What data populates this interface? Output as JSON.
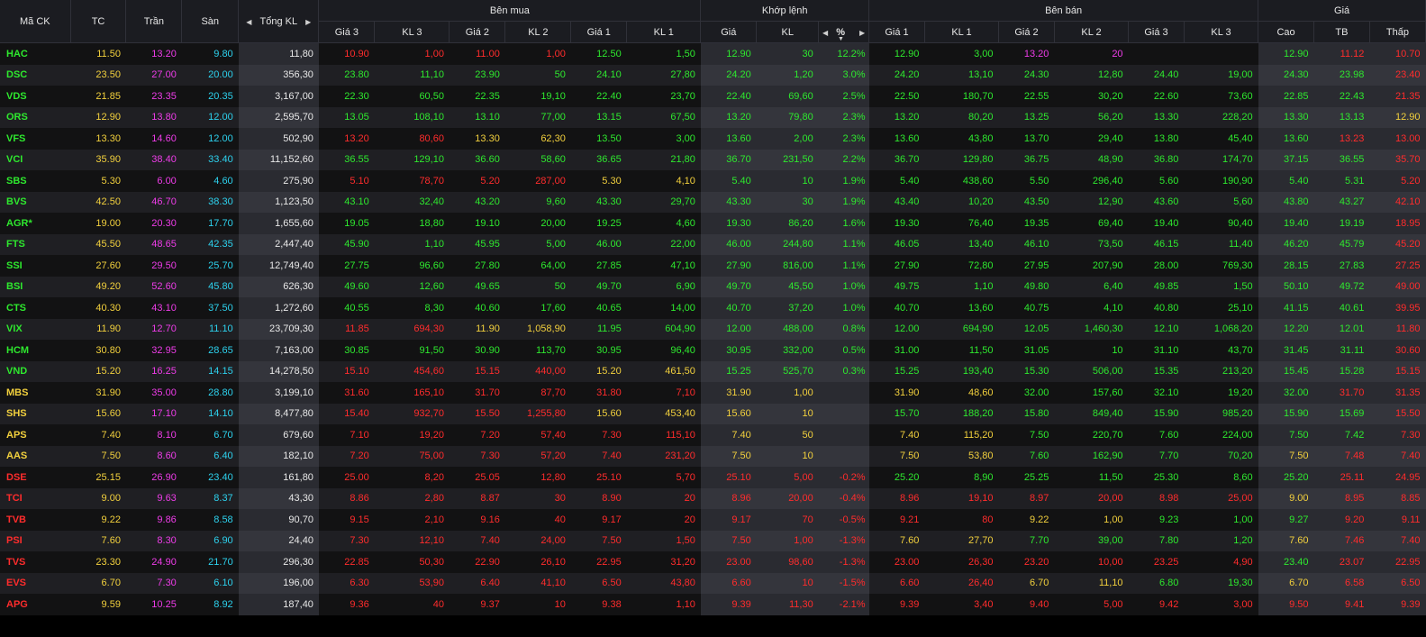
{
  "header": {
    "symbol": "Mã CK",
    "ref": "TC",
    "ceiling": "Trần",
    "floor": "Sàn",
    "total_vol": "Tổng KL",
    "bid_group": "Bên mua",
    "match_group": "Khớp lệnh",
    "ask_group": "Bên bán",
    "price_group": "Giá",
    "bid_cols": [
      "Giá 3",
      "KL 3",
      "Giá 2",
      "KL 2",
      "Giá 1",
      "KL 1"
    ],
    "match_cols": [
      "Giá",
      "KL",
      "%"
    ],
    "ask_cols": [
      "Giá 1",
      "KL 1",
      "Giá 2",
      "KL 2",
      "Giá 3",
      "KL 3"
    ],
    "price_cols": [
      "Cao",
      "TB",
      "Thấp"
    ]
  },
  "colors": {
    "ref": "#f2d03d",
    "ceiling": "#ee3ce8",
    "floor": "#2dd2ee",
    "up": "#2ee82e",
    "down": "#ff2c2c",
    "neutral": "#e8e8e8",
    "background": "#000000",
    "header": "#1b1c21"
  },
  "rows": [
    {
      "sym": "HAC",
      "tc": "11.50",
      "tran": "13.20",
      "san": "9.80",
      "tkl": "11,80",
      "b3": "10.90",
      "bkl3": "1,00",
      "b2": "11.00",
      "bkl2": "1,00",
      "b1": "12.50",
      "bkl1": "1,50",
      "mp": "12.90",
      "mkl": "30",
      "pct": "12.2%",
      "a1": "12.90",
      "akl1": "3,00",
      "a2": "13.20",
      "akl2": "20",
      "a3": "",
      "akl3": "",
      "cao": "12.90",
      "tb": "11.12",
      "thap": "10.70"
    },
    {
      "sym": "DSC",
      "tc": "23.50",
      "tran": "27.00",
      "san": "20.00",
      "tkl": "356,30",
      "b3": "23.80",
      "bkl3": "11,10",
      "b2": "23.90",
      "bkl2": "50",
      "b1": "24.10",
      "bkl1": "27,80",
      "mp": "24.20",
      "mkl": "1,20",
      "pct": "3.0%",
      "a1": "24.20",
      "akl1": "13,10",
      "a2": "24.30",
      "akl2": "12,80",
      "a3": "24.40",
      "akl3": "19,00",
      "cao": "24.30",
      "tb": "23.98",
      "thap": "23.40"
    },
    {
      "sym": "VDS",
      "tc": "21.85",
      "tran": "23.35",
      "san": "20.35",
      "tkl": "3,167,00",
      "b3": "22.30",
      "bkl3": "60,50",
      "b2": "22.35",
      "bkl2": "19,10",
      "b1": "22.40",
      "bkl1": "23,70",
      "mp": "22.40",
      "mkl": "69,60",
      "pct": "2.5%",
      "a1": "22.50",
      "akl1": "180,70",
      "a2": "22.55",
      "akl2": "30,20",
      "a3": "22.60",
      "akl3": "73,60",
      "cao": "22.85",
      "tb": "22.43",
      "thap": "21.35"
    },
    {
      "sym": "ORS",
      "tc": "12.90",
      "tran": "13.80",
      "san": "12.00",
      "tkl": "2,595,70",
      "b3": "13.05",
      "bkl3": "108,10",
      "b2": "13.10",
      "bkl2": "77,00",
      "b1": "13.15",
      "bkl1": "67,50",
      "mp": "13.20",
      "mkl": "79,80",
      "pct": "2.3%",
      "a1": "13.20",
      "akl1": "80,20",
      "a2": "13.25",
      "akl2": "56,20",
      "a3": "13.30",
      "akl3": "228,20",
      "cao": "13.30",
      "tb": "13.13",
      "thap": "12.90"
    },
    {
      "sym": "VFS",
      "tc": "13.30",
      "tran": "14.60",
      "san": "12.00",
      "tkl": "502,90",
      "b3": "13.20",
      "bkl3": "80,60",
      "b2": "13.30",
      "bkl2": "62,30",
      "b1": "13.50",
      "bkl1": "3,00",
      "mp": "13.60",
      "mkl": "2,00",
      "pct": "2.3%",
      "a1": "13.60",
      "akl1": "43,80",
      "a2": "13.70",
      "akl2": "29,40",
      "a3": "13.80",
      "akl3": "45,40",
      "cao": "13.60",
      "tb": "13.23",
      "thap": "13.00"
    },
    {
      "sym": "VCI",
      "tc": "35.90",
      "tran": "38.40",
      "san": "33.40",
      "tkl": "11,152,60",
      "b3": "36.55",
      "bkl3": "129,10",
      "b2": "36.60",
      "bkl2": "58,60",
      "b1": "36.65",
      "bkl1": "21,80",
      "mp": "36.70",
      "mkl": "231,50",
      "pct": "2.2%",
      "a1": "36.70",
      "akl1": "129,80",
      "a2": "36.75",
      "akl2": "48,90",
      "a3": "36.80",
      "akl3": "174,70",
      "cao": "37.15",
      "tb": "36.55",
      "thap": "35.70"
    },
    {
      "sym": "SBS",
      "tc": "5.30",
      "tran": "6.00",
      "san": "4.60",
      "tkl": "275,90",
      "b3": "5.10",
      "bkl3": "78,70",
      "b2": "5.20",
      "bkl2": "287,00",
      "b1": "5.30",
      "bkl1": "4,10",
      "mp": "5.40",
      "mkl": "10",
      "pct": "1.9%",
      "a1": "5.40",
      "akl1": "438,60",
      "a2": "5.50",
      "akl2": "296,40",
      "a3": "5.60",
      "akl3": "190,90",
      "cao": "5.40",
      "tb": "5.31",
      "thap": "5.20"
    },
    {
      "sym": "BVS",
      "tc": "42.50",
      "tran": "46.70",
      "san": "38.30",
      "tkl": "1,123,50",
      "b3": "43.10",
      "bkl3": "32,40",
      "b2": "43.20",
      "bkl2": "9,60",
      "b1": "43.30",
      "bkl1": "29,70",
      "mp": "43.30",
      "mkl": "30",
      "pct": "1.9%",
      "a1": "43.40",
      "akl1": "10,20",
      "a2": "43.50",
      "akl2": "12,90",
      "a3": "43.60",
      "akl3": "5,60",
      "cao": "43.80",
      "tb": "43.27",
      "thap": "42.10"
    },
    {
      "sym": "AGR*",
      "tc": "19.00",
      "tran": "20.30",
      "san": "17.70",
      "tkl": "1,655,60",
      "b3": "19.05",
      "bkl3": "18,80",
      "b2": "19.10",
      "bkl2": "20,00",
      "b1": "19.25",
      "bkl1": "4,60",
      "mp": "19.30",
      "mkl": "86,20",
      "pct": "1.6%",
      "a1": "19.30",
      "akl1": "76,40",
      "a2": "19.35",
      "akl2": "69,40",
      "a3": "19.40",
      "akl3": "90,40",
      "cao": "19.40",
      "tb": "19.19",
      "thap": "18.95"
    },
    {
      "sym": "FTS",
      "tc": "45.50",
      "tran": "48.65",
      "san": "42.35",
      "tkl": "2,447,40",
      "b3": "45.90",
      "bkl3": "1,10",
      "b2": "45.95",
      "bkl2": "5,00",
      "b1": "46.00",
      "bkl1": "22,00",
      "mp": "46.00",
      "mkl": "244,80",
      "pct": "1.1%",
      "a1": "46.05",
      "akl1": "13,40",
      "a2": "46.10",
      "akl2": "73,50",
      "a3": "46.15",
      "akl3": "11,40",
      "cao": "46.20",
      "tb": "45.79",
      "thap": "45.20"
    },
    {
      "sym": "SSI",
      "tc": "27.60",
      "tran": "29.50",
      "san": "25.70",
      "tkl": "12,749,40",
      "b3": "27.75",
      "bkl3": "96,60",
      "b2": "27.80",
      "bkl2": "64,00",
      "b1": "27.85",
      "bkl1": "47,10",
      "mp": "27.90",
      "mkl": "816,00",
      "pct": "1.1%",
      "a1": "27.90",
      "akl1": "72,80",
      "a2": "27.95",
      "akl2": "207,90",
      "a3": "28.00",
      "akl3": "769,30",
      "cao": "28.15",
      "tb": "27.83",
      "thap": "27.25"
    },
    {
      "sym": "BSI",
      "tc": "49.20",
      "tran": "52.60",
      "san": "45.80",
      "tkl": "626,30",
      "b3": "49.60",
      "bkl3": "12,60",
      "b2": "49.65",
      "bkl2": "50",
      "b1": "49.70",
      "bkl1": "6,90",
      "mp": "49.70",
      "mkl": "45,50",
      "pct": "1.0%",
      "a1": "49.75",
      "akl1": "1,10",
      "a2": "49.80",
      "akl2": "6,40",
      "a3": "49.85",
      "akl3": "1,50",
      "cao": "50.10",
      "tb": "49.72",
      "thap": "49.00"
    },
    {
      "sym": "CTS",
      "tc": "40.30",
      "tran": "43.10",
      "san": "37.50",
      "tkl": "1,272,60",
      "b3": "40.55",
      "bkl3": "8,30",
      "b2": "40.60",
      "bkl2": "17,60",
      "b1": "40.65",
      "bkl1": "14,00",
      "mp": "40.70",
      "mkl": "37,20",
      "pct": "1.0%",
      "a1": "40.70",
      "akl1": "13,60",
      "a2": "40.75",
      "akl2": "4,10",
      "a3": "40.80",
      "akl3": "25,10",
      "cao": "41.15",
      "tb": "40.61",
      "thap": "39.95"
    },
    {
      "sym": "VIX",
      "tc": "11.90",
      "tran": "12.70",
      "san": "11.10",
      "tkl": "23,709,30",
      "b3": "11.85",
      "bkl3": "694,30",
      "b2": "11.90",
      "bkl2": "1,058,90",
      "b1": "11.95",
      "bkl1": "604,90",
      "mp": "12.00",
      "mkl": "488,00",
      "pct": "0.8%",
      "a1": "12.00",
      "akl1": "694,90",
      "a2": "12.05",
      "akl2": "1,460,30",
      "a3": "12.10",
      "akl3": "1,068,20",
      "cao": "12.20",
      "tb": "12.01",
      "thap": "11.80"
    },
    {
      "sym": "HCM",
      "tc": "30.80",
      "tran": "32.95",
      "san": "28.65",
      "tkl": "7,163,00",
      "b3": "30.85",
      "bkl3": "91,50",
      "b2": "30.90",
      "bkl2": "113,70",
      "b1": "30.95",
      "bkl1": "96,40",
      "mp": "30.95",
      "mkl": "332,00",
      "pct": "0.5%",
      "a1": "31.00",
      "akl1": "11,50",
      "a2": "31.05",
      "akl2": "10",
      "a3": "31.10",
      "akl3": "43,70",
      "cao": "31.45",
      "tb": "31.11",
      "thap": "30.60"
    },
    {
      "sym": "VND",
      "tc": "15.20",
      "tran": "16.25",
      "san": "14.15",
      "tkl": "14,278,50",
      "b3": "15.10",
      "bkl3": "454,60",
      "b2": "15.15",
      "bkl2": "440,00",
      "b1": "15.20",
      "bkl1": "461,50",
      "mp": "15.25",
      "mkl": "525,70",
      "pct": "0.3%",
      "a1": "15.25",
      "akl1": "193,40",
      "a2": "15.30",
      "akl2": "506,00",
      "a3": "15.35",
      "akl3": "213,20",
      "cao": "15.45",
      "tb": "15.28",
      "thap": "15.15"
    },
    {
      "sym": "MBS",
      "tc": "31.90",
      "tran": "35.00",
      "san": "28.80",
      "tkl": "3,199,10",
      "b3": "31.60",
      "bkl3": "165,10",
      "b2": "31.70",
      "bkl2": "87,70",
      "b1": "31.80",
      "bkl1": "7,10",
      "mp": "31.90",
      "mkl": "1,00",
      "pct": "",
      "a1": "31.90",
      "akl1": "48,60",
      "a2": "32.00",
      "akl2": "157,60",
      "a3": "32.10",
      "akl3": "19,20",
      "cao": "32.00",
      "tb": "31.70",
      "thap": "31.35"
    },
    {
      "sym": "SHS",
      "tc": "15.60",
      "tran": "17.10",
      "san": "14.10",
      "tkl": "8,477,80",
      "b3": "15.40",
      "bkl3": "932,70",
      "b2": "15.50",
      "bkl2": "1,255,80",
      "b1": "15.60",
      "bkl1": "453,40",
      "mp": "15.60",
      "mkl": "10",
      "pct": "",
      "a1": "15.70",
      "akl1": "188,20",
      "a2": "15.80",
      "akl2": "849,40",
      "a3": "15.90",
      "akl3": "985,20",
      "cao": "15.90",
      "tb": "15.69",
      "thap": "15.50"
    },
    {
      "sym": "APS",
      "tc": "7.40",
      "tran": "8.10",
      "san": "6.70",
      "tkl": "679,60",
      "b3": "7.10",
      "bkl3": "19,20",
      "b2": "7.20",
      "bkl2": "57,40",
      "b1": "7.30",
      "bkl1": "115,10",
      "mp": "7.40",
      "mkl": "50",
      "pct": "",
      "a1": "7.40",
      "akl1": "115,20",
      "a2": "7.50",
      "akl2": "220,70",
      "a3": "7.60",
      "akl3": "224,00",
      "cao": "7.50",
      "tb": "7.42",
      "thap": "7.30"
    },
    {
      "sym": "AAS",
      "tc": "7.50",
      "tran": "8.60",
      "san": "6.40",
      "tkl": "182,10",
      "b3": "7.20",
      "bkl3": "75,00",
      "b2": "7.30",
      "bkl2": "57,20",
      "b1": "7.40",
      "bkl1": "231,20",
      "mp": "7.50",
      "mkl": "10",
      "pct": "",
      "a1": "7.50",
      "akl1": "53,80",
      "a2": "7.60",
      "akl2": "162,90",
      "a3": "7.70",
      "akl3": "70,20",
      "cao": "7.50",
      "tb": "7.48",
      "thap": "7.40"
    },
    {
      "sym": "DSE",
      "tc": "25.15",
      "tran": "26.90",
      "san": "23.40",
      "tkl": "161,80",
      "b3": "25.00",
      "bkl3": "8,20",
      "b2": "25.05",
      "bkl2": "12,80",
      "b1": "25.10",
      "bkl1": "5,70",
      "mp": "25.10",
      "mkl": "5,00",
      "pct": "-0.2%",
      "a1": "25.20",
      "akl1": "8,90",
      "a2": "25.25",
      "akl2": "11,50",
      "a3": "25.30",
      "akl3": "8,60",
      "cao": "25.20",
      "tb": "25.11",
      "thap": "24.95"
    },
    {
      "sym": "TCI",
      "tc": "9.00",
      "tran": "9.63",
      "san": "8.37",
      "tkl": "43,30",
      "b3": "8.86",
      "bkl3": "2,80",
      "b2": "8.87",
      "bkl2": "30",
      "b1": "8.90",
      "bkl1": "20",
      "mp": "8.96",
      "mkl": "20,00",
      "pct": "-0.4%",
      "a1": "8.96",
      "akl1": "19,10",
      "a2": "8.97",
      "akl2": "20,00",
      "a3": "8.98",
      "akl3": "25,00",
      "cao": "9.00",
      "tb": "8.95",
      "thap": "8.85"
    },
    {
      "sym": "TVB",
      "tc": "9.22",
      "tran": "9.86",
      "san": "8.58",
      "tkl": "90,70",
      "b3": "9.15",
      "bkl3": "2,10",
      "b2": "9.16",
      "bkl2": "40",
      "b1": "9.17",
      "bkl1": "20",
      "mp": "9.17",
      "mkl": "70",
      "pct": "-0.5%",
      "a1": "9.21",
      "akl1": "80",
      "a2": "9.22",
      "akl2": "1,00",
      "a3": "9.23",
      "akl3": "1,00",
      "cao": "9.27",
      "tb": "9.20",
      "thap": "9.11"
    },
    {
      "sym": "PSI",
      "tc": "7.60",
      "tran": "8.30",
      "san": "6.90",
      "tkl": "24,40",
      "b3": "7.30",
      "bkl3": "12,10",
      "b2": "7.40",
      "bkl2": "24,00",
      "b1": "7.50",
      "bkl1": "1,50",
      "mp": "7.50",
      "mkl": "1,00",
      "pct": "-1.3%",
      "a1": "7.60",
      "akl1": "27,70",
      "a2": "7.70",
      "akl2": "39,00",
      "a3": "7.80",
      "akl3": "1,20",
      "cao": "7.60",
      "tb": "7.46",
      "thap": "7.40"
    },
    {
      "sym": "TVS",
      "tc": "23.30",
      "tran": "24.90",
      "san": "21.70",
      "tkl": "296,30",
      "b3": "22.85",
      "bkl3": "50,30",
      "b2": "22.90",
      "bkl2": "26,10",
      "b1": "22.95",
      "bkl1": "31,20",
      "mp": "23.00",
      "mkl": "98,60",
      "pct": "-1.3%",
      "a1": "23.00",
      "akl1": "26,30",
      "a2": "23.20",
      "akl2": "10,00",
      "a3": "23.25",
      "akl3": "4,90",
      "cao": "23.40",
      "tb": "23.07",
      "thap": "22.95"
    },
    {
      "sym": "EVS",
      "tc": "6.70",
      "tran": "7.30",
      "san": "6.10",
      "tkl": "196,00",
      "b3": "6.30",
      "bkl3": "53,90",
      "b2": "6.40",
      "bkl2": "41,10",
      "b1": "6.50",
      "bkl1": "43,80",
      "mp": "6.60",
      "mkl": "10",
      "pct": "-1.5%",
      "a1": "6.60",
      "akl1": "26,40",
      "a2": "6.70",
      "akl2": "11,10",
      "a3": "6.80",
      "akl3": "19,30",
      "cao": "6.70",
      "tb": "6.58",
      "thap": "6.50"
    },
    {
      "sym": "APG",
      "tc": "9.59",
      "tran": "10.25",
      "san": "8.92",
      "tkl": "187,40",
      "b3": "9.36",
      "bkl3": "40",
      "b2": "9.37",
      "bkl2": "10",
      "b1": "9.38",
      "bkl1": "1,10",
      "mp": "9.39",
      "mkl": "11,30",
      "pct": "-2.1%",
      "a1": "9.39",
      "akl1": "3,40",
      "a2": "9.40",
      "akl2": "5,00",
      "a3": "9.42",
      "akl3": "3,00",
      "cao": "9.50",
      "tb": "9.41",
      "thap": "9.39"
    }
  ]
}
